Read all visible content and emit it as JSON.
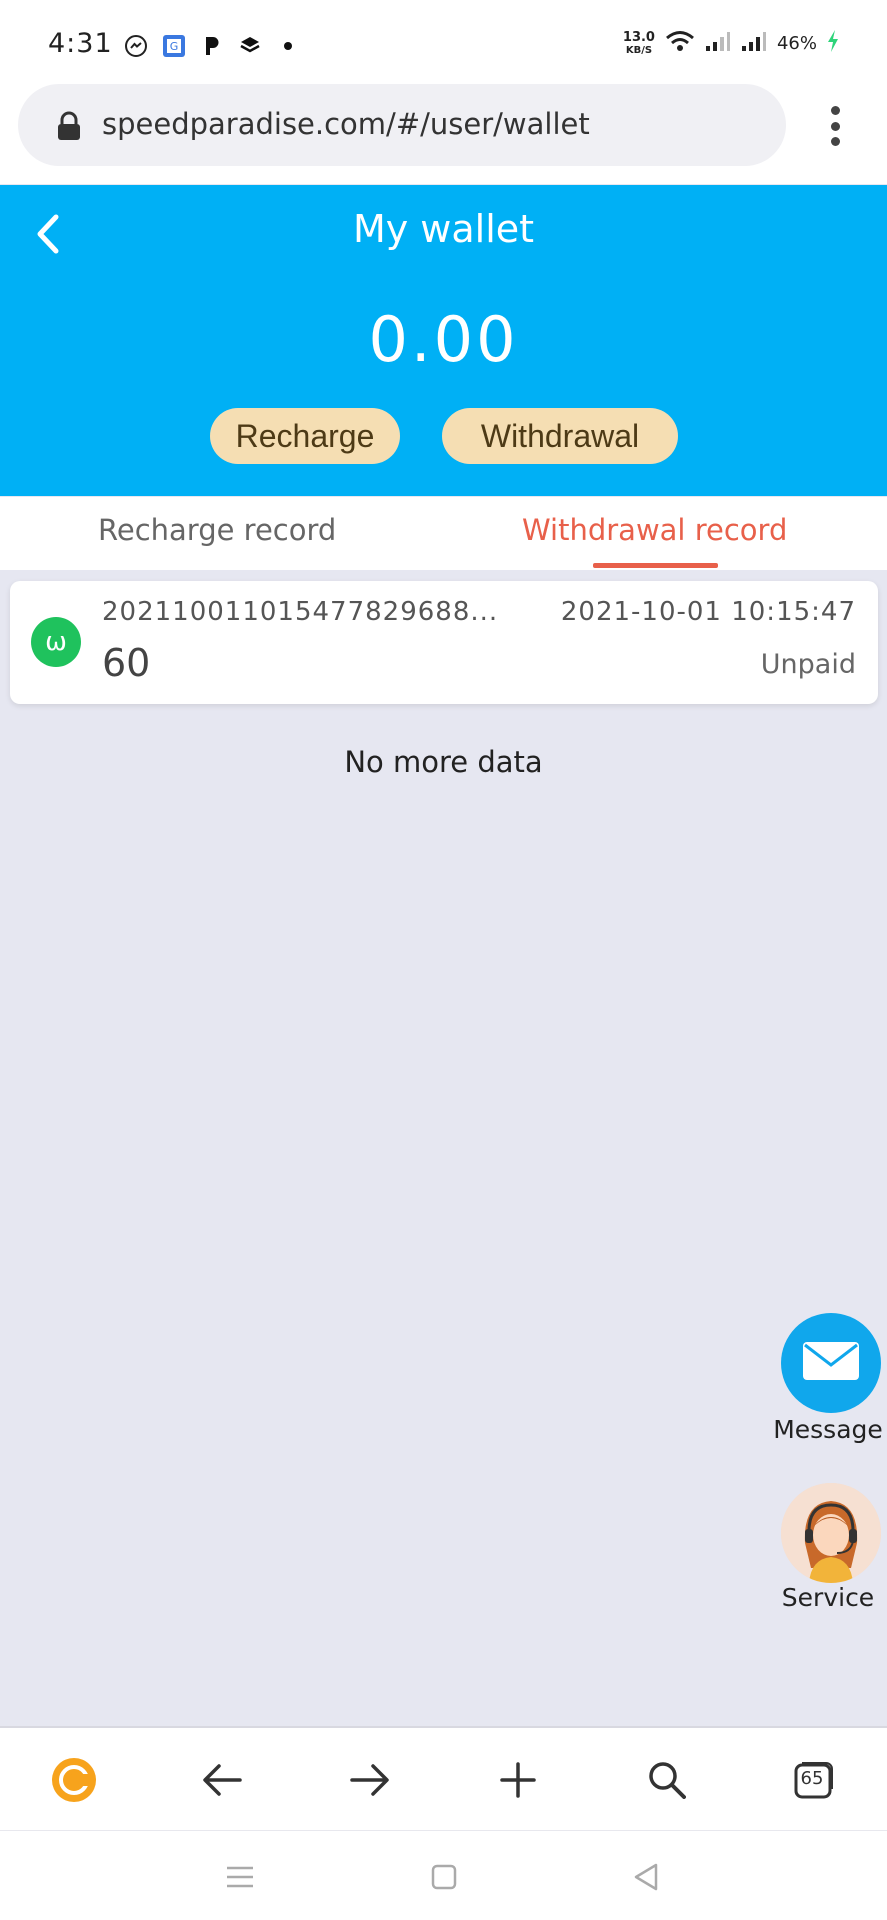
{
  "status_bar": {
    "time": "4:31",
    "speed_value": "13.0",
    "speed_unit": "KB/S",
    "battery": "46%",
    "icons": [
      "messenger-icon",
      "google-translate-icon",
      "p-app-icon",
      "layers-icon",
      "dot-icon",
      "wifi-icon",
      "signal-icon",
      "signal-icon-2",
      "charging-icon"
    ]
  },
  "browser": {
    "url": "speedparadise.com/#/user/wallet",
    "menu_icon": "kebab-menu-icon"
  },
  "header": {
    "title": "My wallet",
    "balance": "0.00",
    "recharge_label": "Recharge",
    "withdrawal_label": "Withdrawal",
    "background_color": "#00b0f5",
    "button_color": "#f5deb3"
  },
  "tabs": [
    {
      "label": "Recharge record",
      "active": false
    },
    {
      "label": "Withdrawal record",
      "active": true
    }
  ],
  "accent_color": "#e8604a",
  "records": [
    {
      "icon_letter": "ω",
      "order_no": "2021100110154778296​88...",
      "time": "2021-10-01 10:15:47",
      "amount": "60",
      "status": "Unpaid"
    }
  ],
  "no_more": "No more data",
  "floating": {
    "message_label": "Message",
    "service_label": "Service"
  },
  "toolbar": {
    "tab_count": "65",
    "items": [
      "c-browser-icon",
      "back-arrow-icon",
      "forward-arrow-icon",
      "plus-icon",
      "search-icon",
      "tabs-icon"
    ]
  },
  "nav": {
    "items": [
      "recents-icon",
      "home-icon",
      "back-triangle-icon"
    ]
  }
}
